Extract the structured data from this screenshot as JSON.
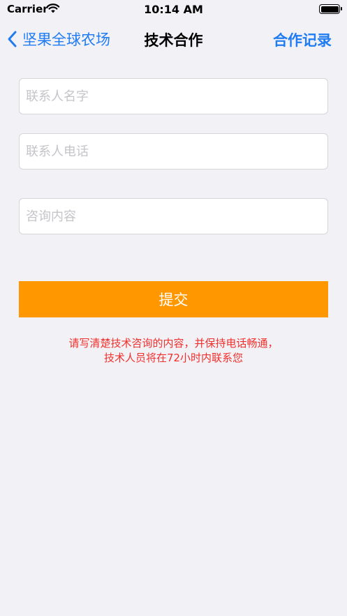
{
  "status_bar": {
    "carrier": "Carrier",
    "time": "10:14 AM"
  },
  "nav": {
    "back_label": "坚果全球农场",
    "title": "技术合作",
    "right_label": "合作记录"
  },
  "form": {
    "name_placeholder": "联系人名字",
    "phone_placeholder": "联系人电话",
    "content_placeholder": "咨询内容",
    "submit_label": "提交"
  },
  "notice": {
    "line1": "请写清楚技术咨询的内容，并保持电话畅通，",
    "line2": "技术人员将在72小时内联系您"
  },
  "colors": {
    "accent": "#1f7cf2",
    "submit": "#ff9800",
    "notice": "#f0302c",
    "background": "#f2f1f6"
  }
}
